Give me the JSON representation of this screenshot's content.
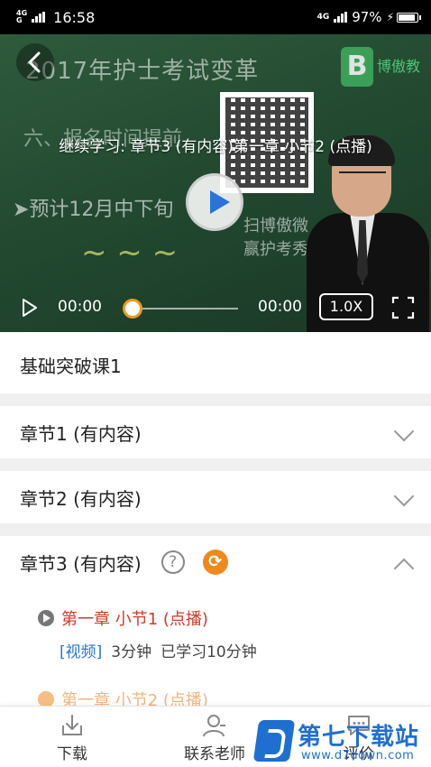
{
  "status_bar": {
    "network_top": "4G",
    "network_bottom": "G",
    "time": "16:58",
    "network_right": "4G",
    "battery": "97%"
  },
  "video": {
    "board_title": "2017年护士考试变革",
    "board_logo_text": "博傲教",
    "board_line1": "六、报名时间提前",
    "board_line2": "➤预计12月中下旬",
    "board_line3": "扫博傲微",
    "board_line4": "赢护考秀",
    "resume_text": "继续学习: 章节3 (有内容)第一章 小节2 (点播)",
    "current_time": "00:00",
    "total_time": "00:00",
    "speed": "1.0X",
    "progress_percent": 0
  },
  "course": {
    "title": "基础突破课1"
  },
  "chapters": [
    {
      "label": "章节1 (有内容)",
      "expanded": false
    },
    {
      "label": "章节2  (有内容)",
      "expanded": false
    },
    {
      "label": "章节3 (有内容)",
      "expanded": true,
      "help": "?",
      "sync": "⟳"
    }
  ],
  "lessons": [
    {
      "title": "第一章 小节1 (点播)",
      "type": "[视频]",
      "duration": "3分钟",
      "progress": "已学习10分钟"
    },
    {
      "title": "第一章 小节2 (点播)"
    }
  ],
  "bottom_nav": {
    "download": "下载",
    "contact": "联系老师",
    "review": "评价"
  },
  "watermark": {
    "name": "第七下载站",
    "url": "www.d7down.com"
  },
  "colors": {
    "accent_blue": "#2a73d9",
    "accent_orange": "#f0891d",
    "lesson_red": "#d23a2a"
  }
}
